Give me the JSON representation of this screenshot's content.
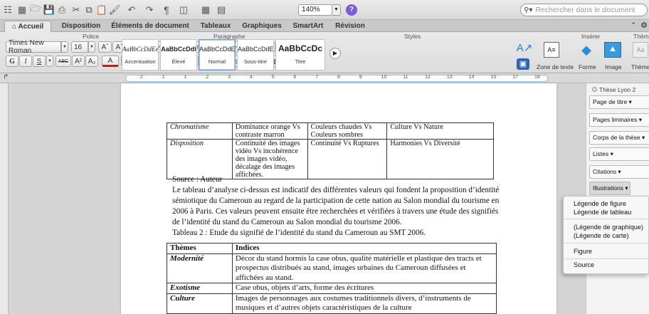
{
  "toolbar": {
    "zoom": "140%",
    "help": "?",
    "search_placeholder": "Rechercher dans le document",
    "pilcrow": "¶"
  },
  "tabs": [
    "Accueil",
    "Disposition",
    "Éléments de document",
    "Tableaux",
    "Graphiques",
    "SmartArt",
    "Révision"
  ],
  "ribbon": {
    "groups": {
      "police": "Police",
      "paragraphe": "Paragraphe",
      "styles": "Styles",
      "inserer": "Insérer",
      "themes": "Thèmes"
    },
    "font_name": "Times New Roman",
    "font_size": "16",
    "bold": "G",
    "italic": "I",
    "underline": "S",
    "styles": [
      {
        "sample": "AaBbCcDdEe",
        "name": "Accentuation"
      },
      {
        "sample": "AaBbCcDdI",
        "name": "Élevé"
      },
      {
        "sample": "AaBbCcDdE",
        "name": "Normal"
      },
      {
        "sample": "AaBbCcDdEe",
        "name": "Sous-titre"
      },
      {
        "sample": "AaBbCcDc",
        "name": "Titre"
      }
    ],
    "insert_labels": [
      "Zone de texte",
      "Forme",
      "Image",
      "Thèmes"
    ]
  },
  "ruler_marks": [
    "2",
    "1",
    "1",
    "2",
    "3",
    "4",
    "5",
    "6",
    "7",
    "8",
    "9",
    "10",
    "11",
    "12",
    "13",
    "14",
    "15",
    "17",
    "18"
  ],
  "document": {
    "table1": [
      [
        "Chromatisme",
        "Dominance orange Vs contraste marron",
        "Couleurs chaudes Vs Couleurs sombres",
        "Culture Vs Nature"
      ],
      [
        "Disposition",
        "Continuité des images vidéo Vs incohérence des images vidéo, décalage des images affichées.",
        "Continuité Vs Ruptures",
        "Harmonies Vs Diversité"
      ]
    ],
    "source": "Source : Auteur",
    "paragraph": "Le tableau d’analyse  ci-dessus est indicatif des différentes valeurs qui fondent la proposition d’identité sémiotique du Cameroun au regard de la participation de cette nation au Salon mondial du tourisme en 2006 à Paris. Ces valeurs peuvent ensuite être recherchées et vérifiées à travers une étude des signifiés de l’identité du stand du Cameroun au Salon mondial du tourisme 2006.",
    "caption": "Tableau 2 : Etude du signifié de l’identité du stand du Cameroun au SMT 2006.",
    "table2_headers": [
      "Thèmes",
      "Indices"
    ],
    "table2": [
      [
        "Modernité",
        "Décor du stand hormis la case obus, qualité matérielle et plastique des tracts et prospectus distribués au stand, images urbaines du Cameroun diffusées et affichées au stand."
      ],
      [
        "Exotisme",
        "Case obus, objets d’arts, forme des écritures"
      ],
      [
        "Culture",
        "Images de personnages aux costumes traditionnels divers, d’instruments de musiques et d’autres objets caractéristiques de la culture"
      ]
    ]
  },
  "panel": {
    "title": "Thèse Lyon 2",
    "items": [
      "Page de titre ▾",
      "Pages liminaires ▾",
      "Corps de la thèse ▾",
      "Listes ▾",
      "Citations ▾",
      "Illustrations ▾"
    ]
  },
  "popup": {
    "items": [
      "Légende de figure",
      "Légende de tableau",
      "(Légende de graphique)",
      "(Légende de carte)",
      "Figure",
      "Source"
    ]
  }
}
